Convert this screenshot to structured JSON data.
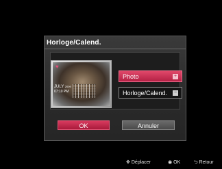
{
  "dialog": {
    "title": "Horloge/Calend.",
    "options": [
      {
        "label": "Photo",
        "selected": true
      },
      {
        "label": "Horloge/Calend.",
        "selected": false
      }
    ],
    "ok_label": "OK",
    "cancel_label": "Annuler",
    "preview": {
      "month": "JULY",
      "year": "2009",
      "time": "07:10 PM"
    }
  },
  "footer": {
    "move_label": "Déplacer",
    "ok_label": "OK",
    "back_label": "Retour"
  },
  "colors": {
    "accent": "#c42b4f",
    "background": "#000000",
    "panel": "#2e2e2e"
  }
}
